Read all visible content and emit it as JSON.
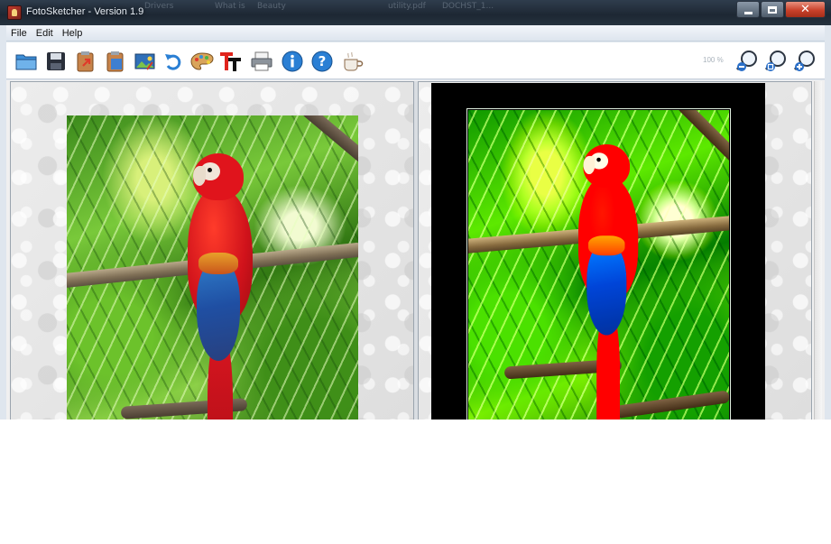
{
  "window": {
    "title": "FotoSketcher - Version 1.9",
    "background_taskbar_labels": [
      "Drivers",
      "What is",
      "Beauty",
      "utility.pdf",
      "DOCHST_1..."
    ]
  },
  "menu": {
    "items": [
      {
        "label": "File"
      },
      {
        "label": "Edit"
      },
      {
        "label": "Help"
      }
    ]
  },
  "toolbar": {
    "buttons": [
      {
        "name": "open-button",
        "icon": "folder-icon"
      },
      {
        "name": "save-button",
        "icon": "floppy-disk-icon"
      },
      {
        "name": "paste-original-button",
        "icon": "clipboard-arrow-icon"
      },
      {
        "name": "paste-result-button",
        "icon": "clipboard-icon"
      },
      {
        "name": "image-button",
        "icon": "picture-icon"
      },
      {
        "name": "undo-button",
        "icon": "undo-arrow-icon"
      },
      {
        "name": "drawing-parameters-button",
        "icon": "palette-icon"
      },
      {
        "name": "add-text-button",
        "icon": "text-icon"
      },
      {
        "name": "print-button",
        "icon": "printer-icon"
      },
      {
        "name": "info-button",
        "icon": "info-icon"
      },
      {
        "name": "help-button",
        "icon": "help-icon"
      },
      {
        "name": "donate-button",
        "icon": "coffee-cup-icon"
      }
    ],
    "zoom_level": "100 %",
    "zoom_buttons": [
      {
        "name": "zoom-out-button",
        "icon": "zoom-out-icon"
      },
      {
        "name": "zoom-fit-button",
        "icon": "zoom-fit-icon"
      },
      {
        "name": "zoom-in-button",
        "icon": "zoom-in-icon"
      }
    ]
  },
  "colors": {
    "titlebar": "#1d2733",
    "close_button": "#c9412b",
    "toolbar_icon_blue": "#2a7fd4",
    "result_frame": "#000000"
  }
}
